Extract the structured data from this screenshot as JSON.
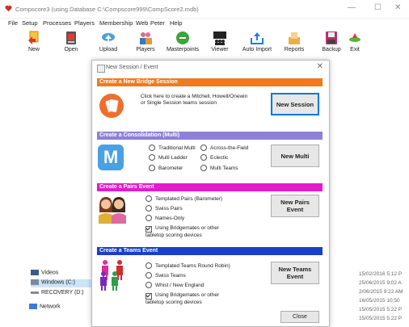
{
  "window": {
    "title": "Compscore3 (using Database C:\\Compscore999\\CompScore2.mdb)",
    "accent": "#d42b2b"
  },
  "menu": [
    "File",
    "Setup",
    "Processes",
    "Players",
    "Membership",
    "Web",
    "Peter",
    "Help"
  ],
  "toolbar": [
    {
      "label": "New",
      "icon": "new-icon"
    },
    {
      "label": "Open",
      "icon": "open-icon"
    },
    {
      "label": "Upload",
      "icon": "upload-icon"
    },
    {
      "label": "Players",
      "icon": "players-icon"
    },
    {
      "label": "Masterpoints",
      "icon": "masterpoints-icon"
    },
    {
      "label": "Viewer",
      "icon": "viewer-icon"
    },
    {
      "label": "Auto Import",
      "icon": "auto-import-icon"
    },
    {
      "label": "Reports",
      "icon": "reports-icon"
    },
    {
      "label": "Backup",
      "icon": "backup-icon"
    },
    {
      "label": "Exit",
      "icon": "exit-icon"
    }
  ],
  "explorer": {
    "items": [
      {
        "label": "Videos",
        "icon": "videos-folder-icon"
      },
      {
        "label": "Windows (C:)",
        "icon": "drive-icon"
      },
      {
        "label": "RECOVERY (D:)",
        "icon": "drive-icon"
      },
      {
        "label": "Network",
        "icon": "network-icon"
      }
    ],
    "dates": [
      "15/02/2016 5:12 P",
      "25/06/2015 9:02 A",
      "2/06/2015 9:22 AM",
      "16/05/2015 10:50",
      "15/05/2015 5:22 P",
      "15/05/2015 5:22 P"
    ]
  },
  "dialog": {
    "title": "New Session / Event",
    "close_label": "Close",
    "sections": {
      "session": {
        "header": "Create a New Bridge Session",
        "color": "#f07a1f",
        "description": "Click here to create a Mitchell, Howell/Onewin or Single Session teams session",
        "button": "New Session"
      },
      "multi": {
        "header": "Create a Consolidation (Multi)",
        "color": "#8e7fd8",
        "options": [
          "Traditional Multi",
          "Across-the-Field",
          "Multi Ladder",
          "Eclectic",
          "Barometer",
          "Multi Teams"
        ],
        "button": "New Multi",
        "icon_letter": "M"
      },
      "pairs": {
        "header": "Create a Pairs Event",
        "color": "#e21bcc",
        "options": [
          "Templated Pairs (Barometer)",
          "Swiss Pairs",
          "Names-Only"
        ],
        "checkbox": "Using Bridgemates or other tabletop scoring devices",
        "button": "New Pairs Event"
      },
      "teams": {
        "header": "Create a Teams Event",
        "color": "#1a3fc7",
        "options": [
          "Templated Teams Round Robin)",
          "Swiss Teams",
          "Whist / New England"
        ],
        "checkbox": "Using Bridgemates or other tabletop scoring devices",
        "button": "New Teams Event"
      }
    }
  }
}
